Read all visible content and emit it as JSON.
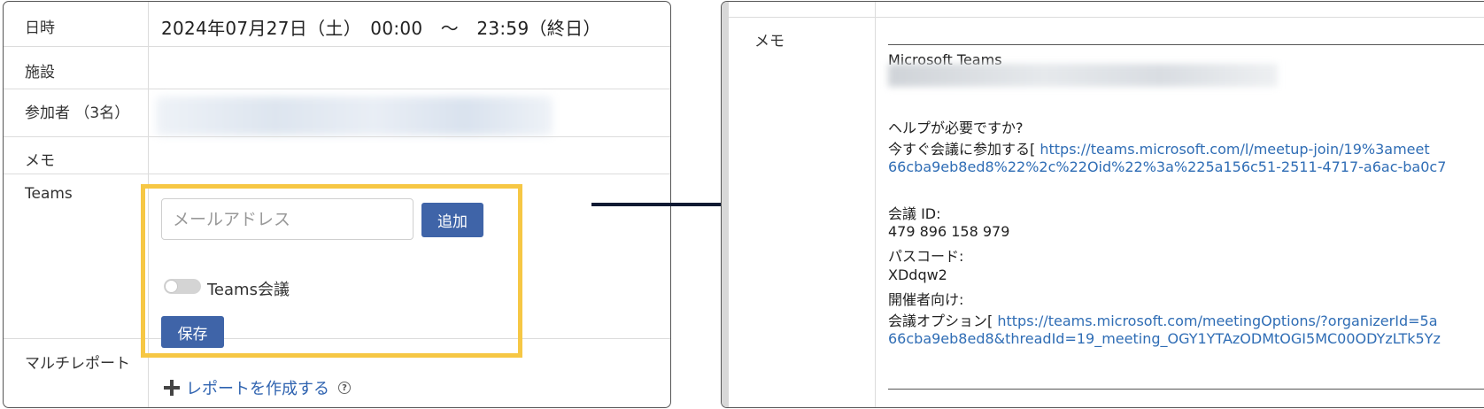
{
  "left": {
    "datetime": {
      "label": "日時",
      "value": "2024年07月27日（土）　00:00　～　23:59（終日）"
    },
    "facility": {
      "label": "施設"
    },
    "participants": {
      "label": "参加者 （3名）"
    },
    "memo": {
      "label": "メモ"
    },
    "teams": {
      "label": "Teams",
      "email_placeholder": "メールアドレス",
      "add_button": "追加",
      "toggle_label": "Teams会議",
      "save_button": "保存"
    },
    "multi_report": {
      "label": "マルチレポート",
      "link": "レポートを作成する",
      "help": "?"
    }
  },
  "right": {
    "label": "メモ",
    "lines": {
      "title": "Microsoft Teams",
      "help_question": "ヘルプが必要ですか?",
      "join_prefix": "今すぐ会議に参加する[ ",
      "join_url": "https://teams.microsoft.com/l/meetup-join/19%3ameet",
      "join_url_cont": "66cba9eb8ed8%22%2c%22Oid%22%3a%225a156c51-2511-4717-a6ac-ba0c7",
      "meeting_id_label": "会議 ID:",
      "meeting_id": "479 896 158 979",
      "passcode_label": "パスコード:",
      "passcode": "XDdqw2",
      "organizer_label": "開催者向け:",
      "options_prefix": "会議オプション[ ",
      "options_url": "https://teams.microsoft.com/meetingOptions/?organizerId=5a",
      "options_url_cont": "66cba9eb8ed8&threadId=19_meeting_OGY1YTAzODMtOGI5MC00ODYzLTk5Yz"
    }
  },
  "colors": {
    "highlight": "#f6c744",
    "button": "#3f64a8",
    "link": "#2f6db5",
    "arrow": "#0f1a33"
  }
}
